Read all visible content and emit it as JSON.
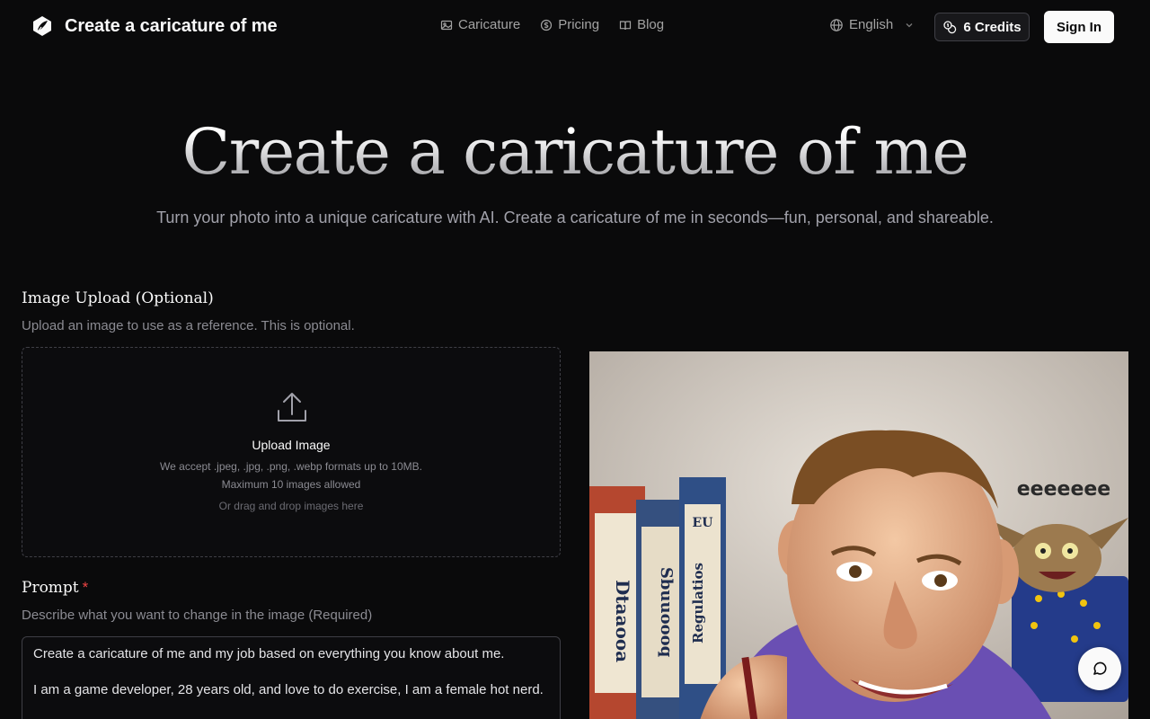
{
  "header": {
    "brand_title": "Create a caricature of me",
    "nav": [
      {
        "label": "Caricature",
        "icon": "image-icon"
      },
      {
        "label": "Pricing",
        "icon": "coin-icon"
      },
      {
        "label": "Blog",
        "icon": "book-icon"
      }
    ],
    "language": "English",
    "credits_label": "6 Credits",
    "signin_label": "Sign In"
  },
  "hero": {
    "title": "Create a caricature of me",
    "subtitle": "Turn your photo into a unique caricature with AI. Create a caricature of me in seconds—fun, personal, and shareable."
  },
  "upload": {
    "title": "Image Upload (Optional)",
    "description": "Upload an image to use as a reference. This is optional.",
    "box_title": "Upload Image",
    "formats": "We accept .jpeg, .jpg, .png, .webp formats up to 10MB.",
    "max": "Maximum 10 images allowed",
    "drag": "Or drag and drop images here"
  },
  "prompt": {
    "title": "Prompt",
    "required_mark": "*",
    "description": "Describe what you want to change in the image (Required)",
    "value_line1": "Create a caricature of me and my job based on everything you know about me.",
    "value_line2": "I am a game developer, 28 years old, and love to do exercise, I am a female hot nerd."
  },
  "preview": {
    "speech_text": "eeeeeee",
    "book_labels": [
      "Dtaaooa",
      "Sbuuoooq",
      "EU",
      "Regulatios"
    ]
  },
  "colors": {
    "background": "#0a0a0b",
    "accent_required": "#ef4444",
    "button_light": "#fafafa"
  }
}
